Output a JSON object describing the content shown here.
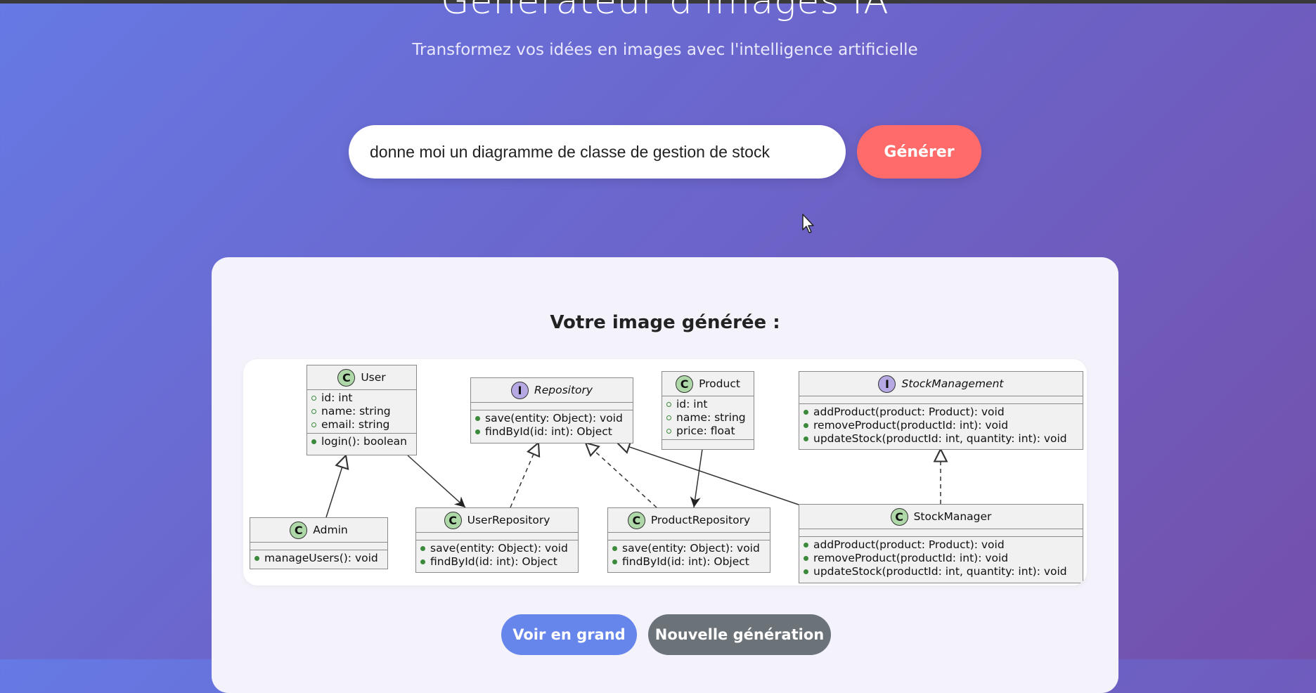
{
  "header": {
    "title": "Générateur d'images IA",
    "subtitle": "Transformez vos idées en images avec l'intelligence artificielle"
  },
  "prompt": {
    "value": "donne moi un diagramme de classe de gestion de stock",
    "button_label": "Générer"
  },
  "result": {
    "title": "Votre image générée :",
    "diagram": {
      "user": {
        "badge": "C",
        "name": "User",
        "fields": [
          "id: int",
          "name: string",
          "email: string"
        ],
        "methods": [
          "login(): boolean"
        ]
      },
      "repository": {
        "badge": "I",
        "name": "Repository",
        "methods": [
          "save(entity: Object): void",
          "findById(id: int): Object"
        ]
      },
      "product": {
        "badge": "C",
        "name": "Product",
        "fields": [
          "id: int",
          "name: string",
          "price: float"
        ]
      },
      "stock_management": {
        "badge": "I",
        "name": "StockManagement",
        "methods": [
          "addProduct(product: Product): void",
          "removeProduct(productId: int): void",
          "updateStock(productId: int, quantity: int): void"
        ]
      },
      "admin": {
        "badge": "C",
        "name": "Admin",
        "methods": [
          "manageUsers(): void"
        ]
      },
      "user_repository": {
        "badge": "C",
        "name": "UserRepository",
        "methods": [
          "save(entity: Object): void",
          "findById(id: int): Object"
        ]
      },
      "product_repository": {
        "badge": "C",
        "name": "ProductRepository",
        "methods": [
          "save(entity: Object): void",
          "findById(id: int): Object"
        ]
      },
      "stock_manager": {
        "badge": "C",
        "name": "StockManager",
        "methods": [
          "addProduct(product: Product): void",
          "removeProduct(productId: int): void",
          "updateStock(productId: int, quantity: int): void"
        ]
      }
    },
    "view_large_label": "Voir en grand",
    "new_generation_label": "Nouvelle génération"
  },
  "colors": {
    "generate_button": "#ff6b6b",
    "view_large_button": "#6786ec",
    "new_generation_button": "#6b7278",
    "class_badge": "#aed8a7",
    "interface_badge": "#b6a8e2"
  }
}
